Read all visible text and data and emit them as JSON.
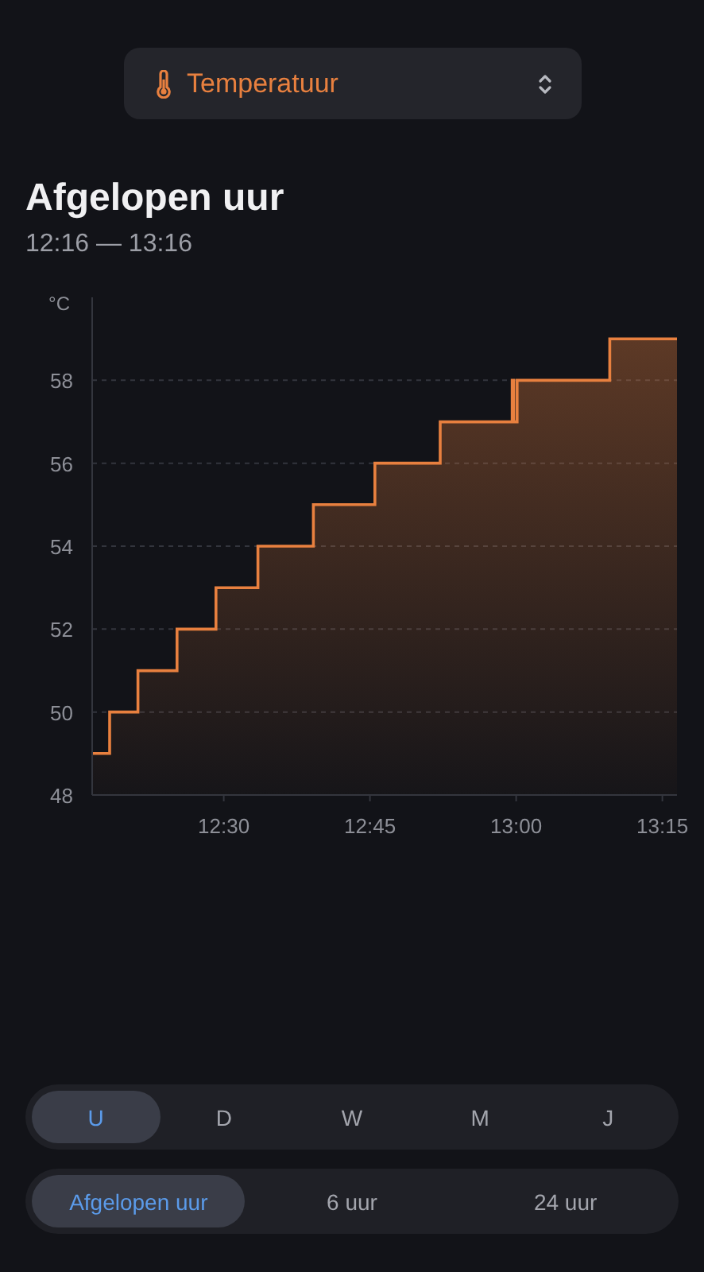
{
  "selector": {
    "label": "Temperatuur"
  },
  "header": {
    "title": "Afgelopen uur",
    "range": "12:16 — 13:16"
  },
  "chart_data": {
    "type": "area",
    "grid": true,
    "ylabel": "°C",
    "xlim": [
      736.5,
      796.5
    ],
    "ylim": [
      48,
      60
    ],
    "xticks": [
      {
        "value": 750,
        "label": "12:30"
      },
      {
        "value": 765,
        "label": "12:45"
      },
      {
        "value": 780,
        "label": "13:00"
      },
      {
        "value": 795,
        "label": "13:15"
      }
    ],
    "yticks": [
      48,
      50,
      52,
      54,
      56,
      58
    ],
    "x": [
      736.5,
      738.3,
      738.3,
      741.2,
      741.2,
      745.2,
      745.2,
      749.2,
      749.2,
      753.5,
      753.5,
      759.2,
      759.2,
      765.5,
      765.5,
      772.2,
      772.2,
      779.6,
      779.6,
      779.75,
      779.75,
      780.1,
      780.1,
      789.6,
      789.6,
      796.5
    ],
    "series": [
      {
        "color": "#e8803f",
        "values": [
          49,
          49,
          50,
          50,
          51,
          51,
          52,
          52,
          53,
          53,
          54,
          54,
          55,
          55,
          56,
          56,
          57,
          57,
          58,
          58,
          57,
          57,
          58,
          58,
          59,
          59
        ]
      }
    ]
  },
  "period_tabs": [
    {
      "label": "U",
      "selected": true
    },
    {
      "label": "D",
      "selected": false
    },
    {
      "label": "W",
      "selected": false
    },
    {
      "label": "M",
      "selected": false
    },
    {
      "label": "J",
      "selected": false
    }
  ],
  "range_tabs": [
    {
      "label": "Afgelopen uur",
      "selected": true
    },
    {
      "label": "6 uur",
      "selected": false
    },
    {
      "label": "24 uur",
      "selected": false
    }
  ]
}
